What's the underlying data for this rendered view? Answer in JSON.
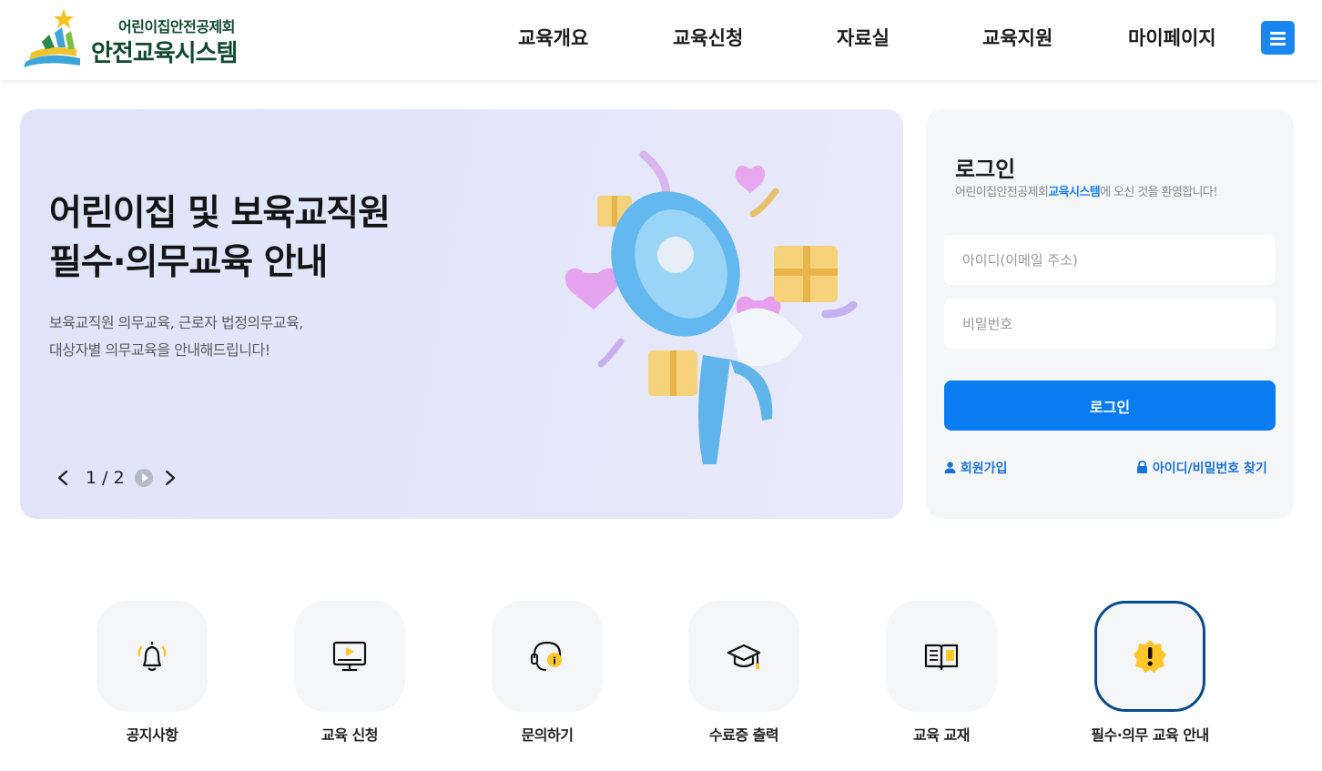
{
  "header": {
    "org_name": "어린이집안전공제회",
    "system_name": "안전교육시스템",
    "nav": [
      "교육개요",
      "교육신청",
      "자료실",
      "교육지원",
      "마이페이지"
    ],
    "menu_icon": "hamburger-icon"
  },
  "banner": {
    "title_line1": "어린이집 및 보육교직원",
    "title_line2": "필수·의무교육 안내",
    "desc_line1": "보육교직원 의무교육, 근로자 법정의무교육,",
    "desc_line2": "대상자별 의무교육을 안내해드립니다!",
    "page_indicator": "1 / 2",
    "current_slide": 1,
    "total_slides": 2,
    "illustration": "megaphone-illustration"
  },
  "login": {
    "title": "로그인",
    "welcome_prefix": "어린이집안전공제회",
    "welcome_highlight": "교육시스템",
    "welcome_suffix": "에 오신 것을 환영합니다!",
    "id_placeholder": "아이디(이메일 주소)",
    "pw_placeholder": "비밀번호",
    "button_label": "로그인",
    "signup_label": "회원가입",
    "find_label": "아이디/비밀번호 찾기"
  },
  "quick_menu": [
    {
      "label": "공지사항",
      "icon": "bell-icon",
      "active": false
    },
    {
      "label": "교육 신청",
      "icon": "monitor-play-icon",
      "active": false
    },
    {
      "label": "문의하기",
      "icon": "headset-icon",
      "active": false
    },
    {
      "label": "수료증 출력",
      "icon": "graduation-cap-icon",
      "active": false
    },
    {
      "label": "교육 교재",
      "icon": "book-icon",
      "active": false
    },
    {
      "label": "필수·의무 교육 안내",
      "icon": "alert-badge-icon",
      "active": true
    }
  ],
  "colors": {
    "brand_green": "#0f4a2e",
    "primary_blue": "#0a7cf2",
    "accent_yellow": "#ffc629",
    "active_border": "#0b4a8c"
  }
}
